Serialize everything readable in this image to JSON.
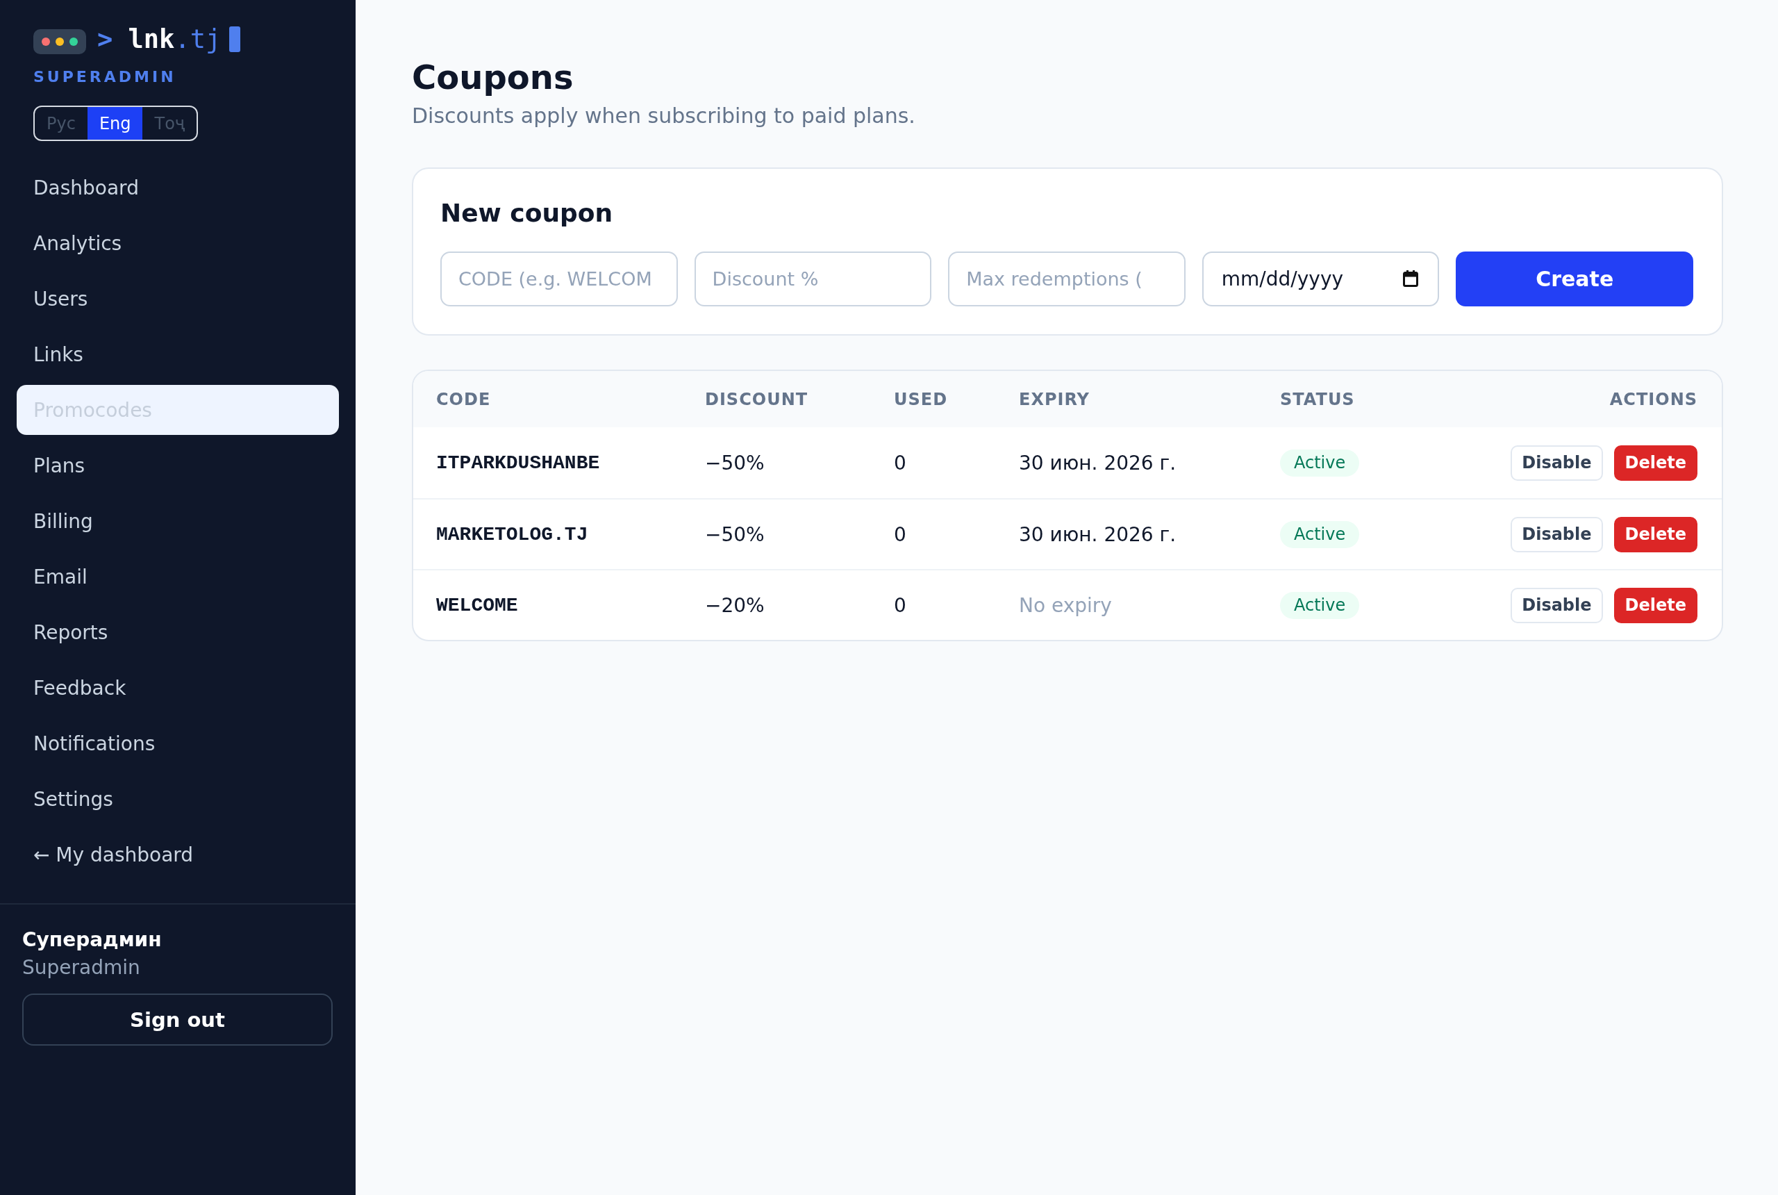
{
  "sidebar": {
    "logo": {
      "prompt": ">",
      "name": "lnk",
      "tld": ".tj"
    },
    "role": "SUPERADMIN",
    "languages": [
      {
        "label": "Рус",
        "selected": false
      },
      {
        "label": "Eng",
        "selected": true
      },
      {
        "label": "Тоҷ",
        "selected": false
      }
    ],
    "nav": [
      {
        "label": "Dashboard",
        "selected": false
      },
      {
        "label": "Analytics",
        "selected": false
      },
      {
        "label": "Users",
        "selected": false
      },
      {
        "label": "Links",
        "selected": false
      },
      {
        "label": "Promocodes",
        "selected": true
      },
      {
        "label": "Plans",
        "selected": false
      },
      {
        "label": "Billing",
        "selected": false
      },
      {
        "label": "Email",
        "selected": false
      },
      {
        "label": "Reports",
        "selected": false
      },
      {
        "label": "Feedback",
        "selected": false
      },
      {
        "label": "Notifications",
        "selected": false
      },
      {
        "label": "Settings",
        "selected": false
      },
      {
        "label": "← My dashboard",
        "selected": false
      }
    ],
    "user": {
      "name": "Суперадмин",
      "role": "Superadmin"
    },
    "sign_out": "Sign out"
  },
  "page": {
    "title": "Coupons",
    "subtitle": "Discounts apply when subscribing to paid plans."
  },
  "new_coupon": {
    "title": "New coupon",
    "fields": [
      {
        "kind": "text",
        "placeholder": "CODE (e.g. WELCOM"
      },
      {
        "kind": "text",
        "placeholder": "Discount %"
      },
      {
        "kind": "text",
        "placeholder": "Max redemptions ("
      },
      {
        "kind": "date",
        "placeholder": "mm/dd/yyyy"
      }
    ],
    "submit": "Create"
  },
  "table": {
    "columns": [
      "CODE",
      "DISCOUNT",
      "USED",
      "EXPIRY",
      "STATUS",
      "ACTIONS"
    ],
    "rows": [
      {
        "code": "ITPARKDUSHANBE",
        "discount": "−50%",
        "used": "0",
        "expiry": "30 июн. 2026 г.",
        "expiry_set": true,
        "status": {
          "label": "Active",
          "kind": "active"
        },
        "actions": [
          {
            "label": "Disable",
            "kind": "disable"
          },
          {
            "label": "Delete",
            "kind": "delete"
          }
        ]
      },
      {
        "code": "MARKETOLOG.TJ",
        "discount": "−50%",
        "used": "0",
        "expiry": "30 июн. 2026 г.",
        "expiry_set": true,
        "status": {
          "label": "Active",
          "kind": "active"
        },
        "actions": [
          {
            "label": "Disable",
            "kind": "disable"
          },
          {
            "label": "Delete",
            "kind": "delete"
          }
        ]
      },
      {
        "code": "WELCOME",
        "discount": "−20%",
        "used": "0",
        "expiry": "No expiry",
        "expiry_set": false,
        "status": {
          "label": "Active",
          "kind": "active"
        },
        "actions": [
          {
            "label": "Disable",
            "kind": "disable"
          },
          {
            "label": "Delete",
            "kind": "delete"
          }
        ]
      }
    ]
  }
}
